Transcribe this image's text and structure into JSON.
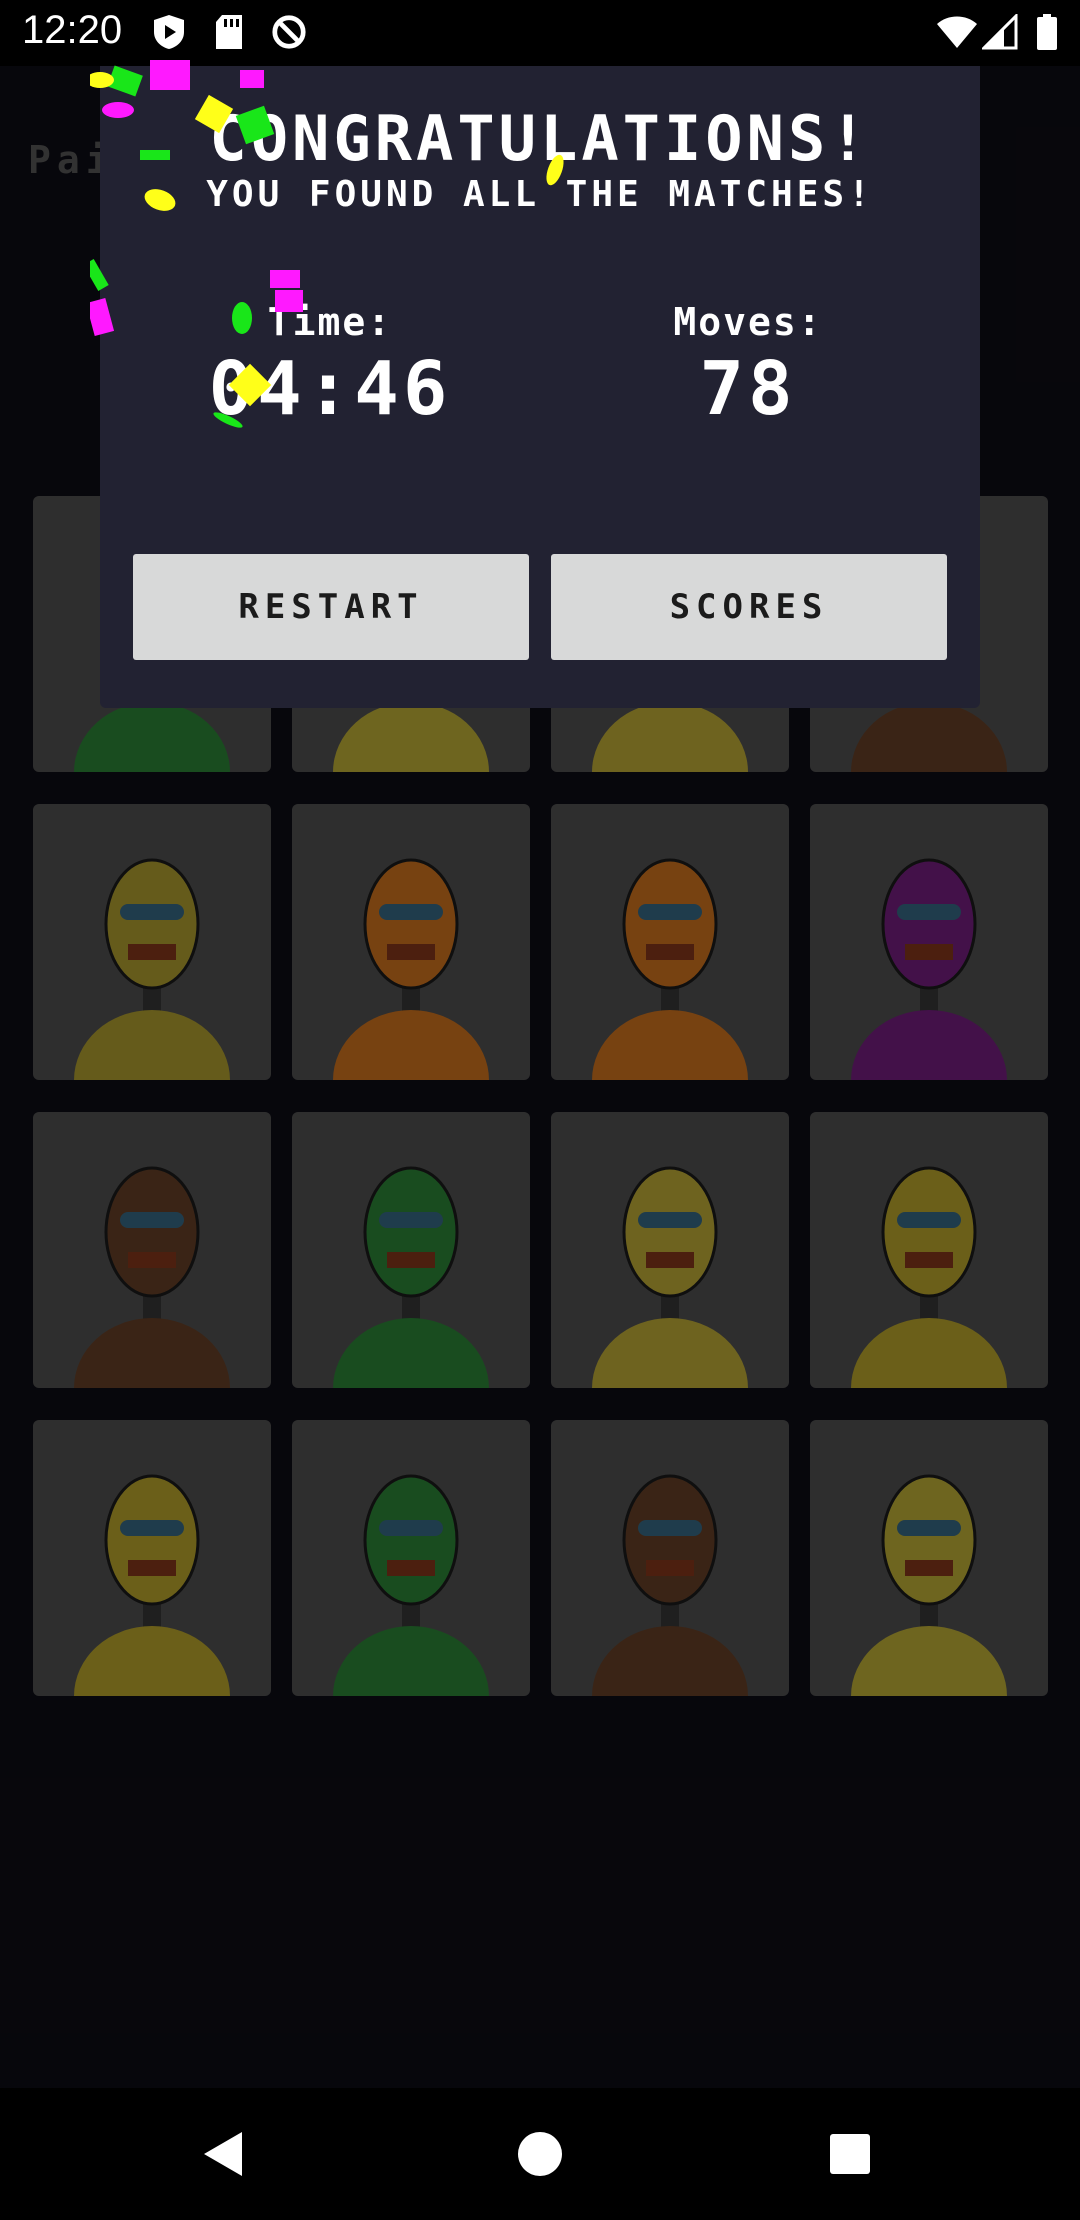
{
  "status_bar": {
    "time": "12:20",
    "icons": [
      "shield-play-icon",
      "sd-card-icon",
      "sync-icon",
      "wifi-icon",
      "signal-icon",
      "battery-icon"
    ]
  },
  "game": {
    "title": "Pai",
    "cards": [
      {
        "robot": "green-cylinder-robot",
        "color": "#2f8a3a"
      },
      {
        "robot": "yellow-box-robot",
        "color": "#c8b83a"
      },
      {
        "robot": "yellow-round-robot",
        "color": "#c9b43a"
      },
      {
        "robot": "brown-box-robot",
        "color": "#6b4328"
      },
      {
        "robot": "yellow-big-robot",
        "color": "#b8a632"
      },
      {
        "robot": "orange-visor-robot",
        "color": "#d9781f"
      },
      {
        "robot": "orange-visor-robot",
        "color": "#d9781f"
      },
      {
        "robot": "purple-antenna-robot",
        "color": "#7a1f86"
      },
      {
        "robot": "brown-mustache-robot",
        "color": "#6b4328"
      },
      {
        "robot": "green-visor-robot",
        "color": "#2f8a3a"
      },
      {
        "robot": "yellow-visor-robot",
        "color": "#c9b43a"
      },
      {
        "robot": "yellow-antenna-robot",
        "color": "#c3ae2e"
      },
      {
        "robot": "yellow-antenna-robot",
        "color": "#c3ae2e"
      },
      {
        "robot": "green-bottle-robot",
        "color": "#2f8a3a"
      },
      {
        "robot": "brown-antenna-robot",
        "color": "#6b4328"
      },
      {
        "robot": "yellow-box-robot",
        "color": "#c8b83a"
      }
    ]
  },
  "dialog": {
    "title": "CONGRATULATIONS!",
    "subtitle": "YOU FOUND ALL THE MATCHES!",
    "time_label": "Time:",
    "time_value": "04:46",
    "moves_label": "Moves:",
    "moves_value": "78",
    "restart_label": "RESTART",
    "scores_label": "SCORES"
  },
  "nav_bar": {
    "icons": [
      "back-icon",
      "home-icon",
      "recents-icon"
    ]
  },
  "colors": {
    "background": "#0e0d16",
    "dialog": "#222232",
    "button": "#d8d9d9",
    "card": "#555555"
  }
}
